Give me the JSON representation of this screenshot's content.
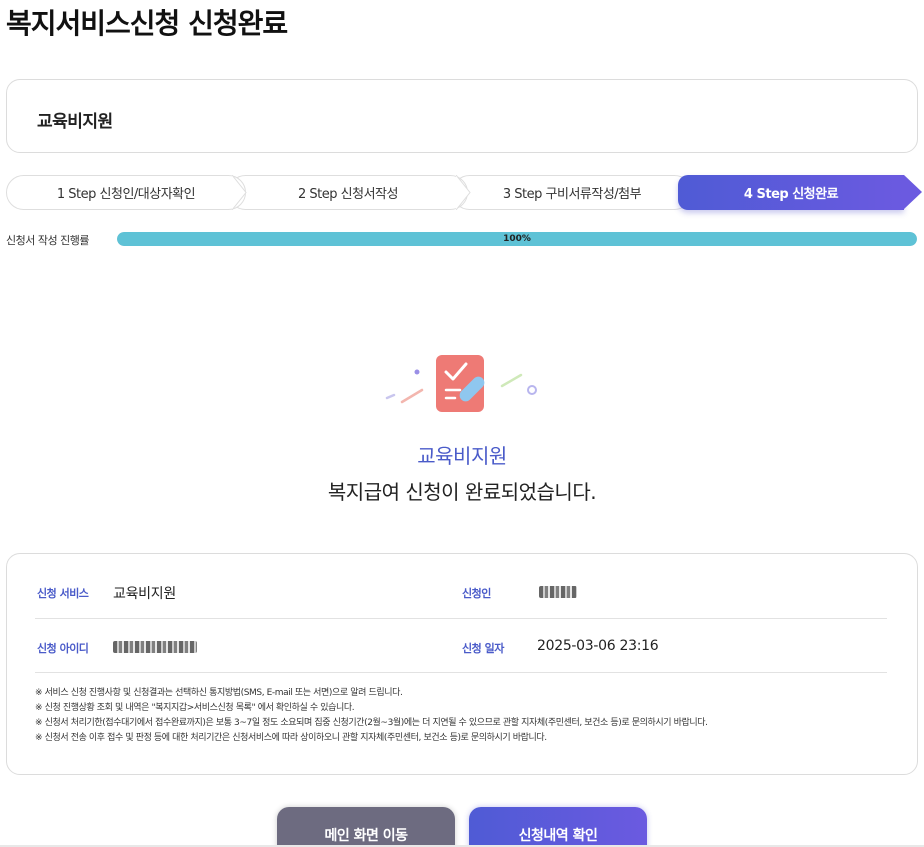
{
  "page": {
    "title": "복지서비스신청 신청완료"
  },
  "service": {
    "name": "교육비지원"
  },
  "steps": [
    {
      "label": "1 Step 신청인/대상자확인",
      "active": false
    },
    {
      "label": "2 Step 신청서작성",
      "active": false
    },
    {
      "label": "3 Step 구비서류작성/첨부",
      "active": false
    },
    {
      "label": "4 Step 신청완료",
      "active": true
    }
  ],
  "progress": {
    "label": "신청서 작성 진행률",
    "value": 100,
    "text": "100%"
  },
  "completion": {
    "service_name": "교육비지원",
    "message": "복지급여 신청이 완료되었습니다."
  },
  "info": {
    "service_label": "신청 서비스",
    "service_value": "교육비지원",
    "applicant_label": "신청인",
    "id_label": "신청 아이디",
    "date_label": "신청 일자",
    "date_value": "2025-03-06 23:16"
  },
  "notes": [
    "※ 서비스 신청 진행사항 및 신청결과는 선택하신 통지방법(SMS, E-mail 또는 서면)으로 알려 드립니다.",
    "※ 신청 진행상황 조회 및 내역은 \"복지지갑>서비스신청 목록\" 에서 확인하실 수 있습니다.",
    "※ 신청서 처리기한(접수대기에서 접수완료까지)은 보통 3~7일 정도 소요되며 집중 신청기간(2월~3월)에는 더 지연될 수 있으므로 관할 지자체(주민센터, 보건소 등)로 문의하시기 바랍니다.",
    "※ 신청서 전송 이후 접수 및 판정 등에 대한 처리기간은 신청서비스에 따라 상이하오니 관할 지자체(주민센터, 보건소 등)로 문의하시기 바랍니다."
  ],
  "buttons": {
    "main_label": "메인 화면 이동",
    "history_label": "신청내역 확인"
  },
  "colors": {
    "accent": "#4a5bc9",
    "progress": "#5ec2d6",
    "gray_button": "#6d6b80"
  }
}
